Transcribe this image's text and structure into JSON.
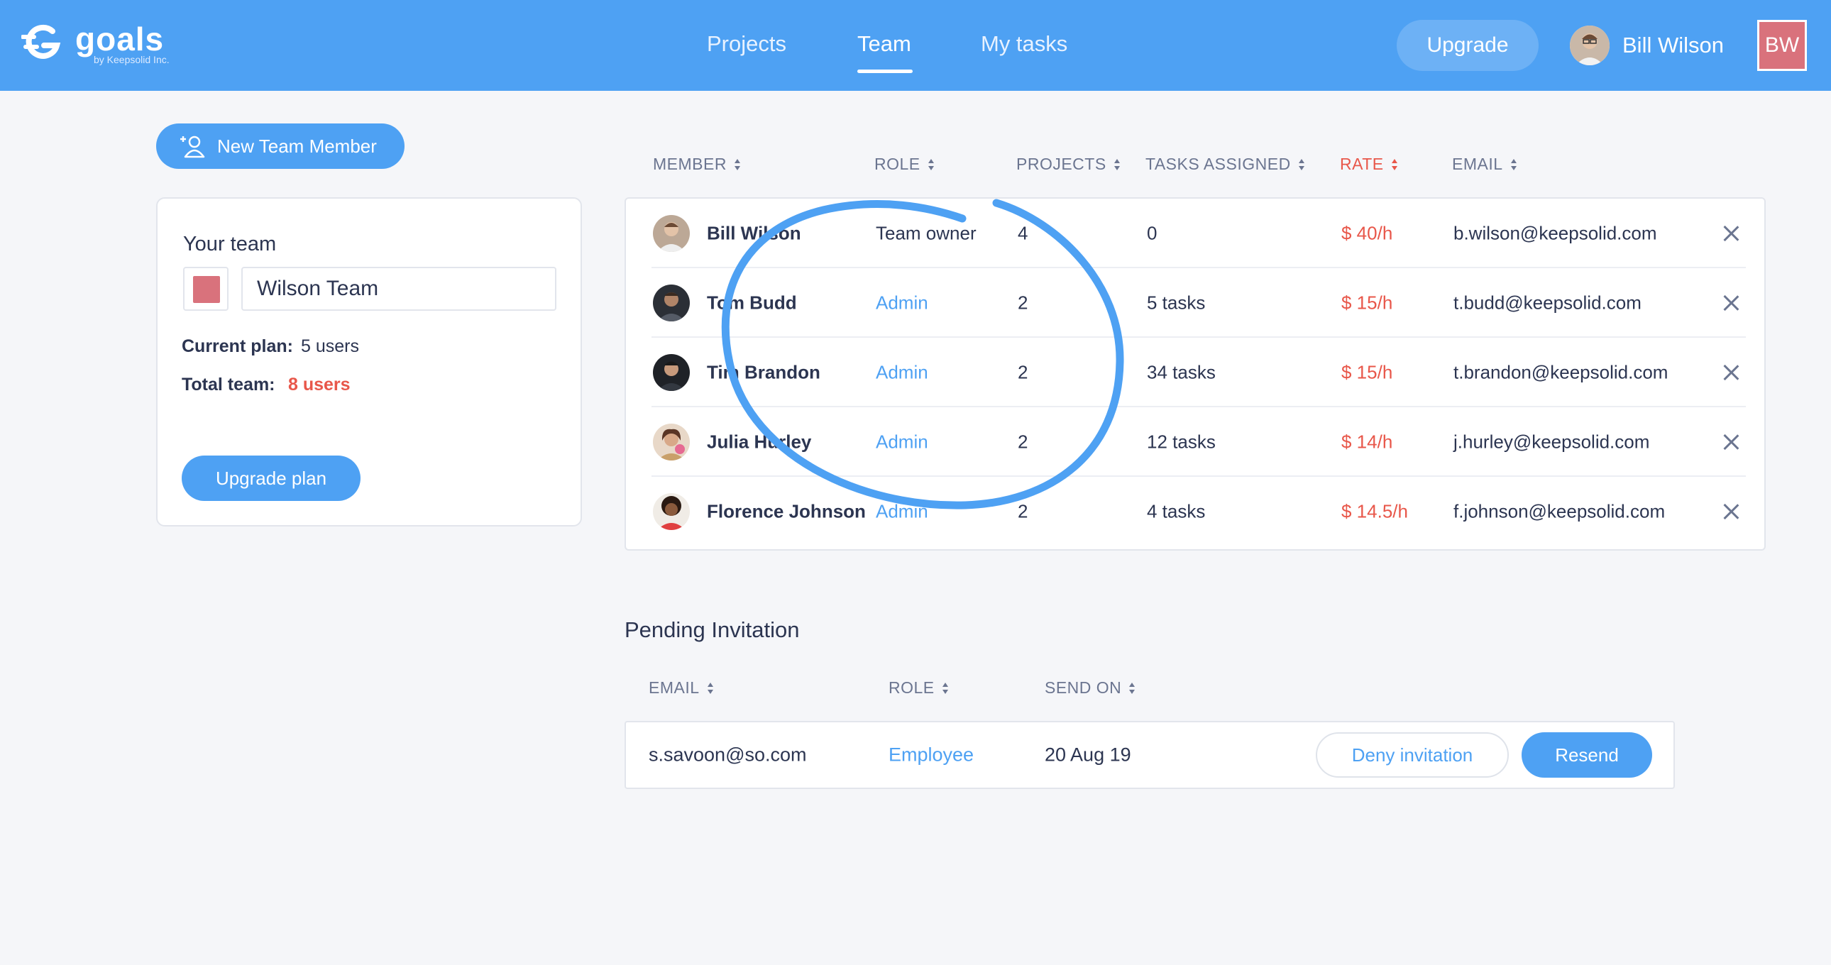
{
  "header": {
    "logo_word": "goals",
    "logo_sub": "by Keepsolid Inc.",
    "nav": [
      "Projects",
      "Team",
      "My tasks"
    ],
    "upgrade_label": "Upgrade",
    "user_name": "Bill Wilson",
    "user_initials": "BW"
  },
  "sidebar": {
    "new_member_label": "New Team Member",
    "card_title": "Your team",
    "team_name": "Wilson Team",
    "current_plan_label": "Current plan:",
    "current_plan_value": "5 users",
    "total_team_label": "Total team:",
    "total_team_value": "8 users",
    "upgrade_plan_label": "Upgrade plan",
    "team_color": "#d9727c"
  },
  "members": {
    "columns": [
      "MEMBER",
      "ROLE",
      "PROJECTS",
      "TASKS ASSIGNED",
      "RATE",
      "EMAIL"
    ],
    "rows": [
      {
        "name": "Bill Wilson",
        "role": "Team owner",
        "projects": "4",
        "tasks": "0",
        "rate": "$ 40/h",
        "email": "b.wilson@keepsolid.com"
      },
      {
        "name": "Tom Budd",
        "role": "Admin",
        "projects": "2",
        "tasks": "5 tasks",
        "rate": "$ 15/h",
        "email": "t.budd@keepsolid.com"
      },
      {
        "name": "Tim Brandon",
        "role": "Admin",
        "projects": "2",
        "tasks": "34 tasks",
        "rate": "$ 15/h",
        "email": "t.brandon@keepsolid.com"
      },
      {
        "name": "Julia Hurley",
        "role": "Admin",
        "projects": "2",
        "tasks": "12 tasks",
        "rate": "$ 14/h",
        "email": "j.hurley@keepsolid.com"
      },
      {
        "name": "Florence Johnson",
        "role": "Admin",
        "projects": "2",
        "tasks": "4 tasks",
        "rate": "$ 14.5/h",
        "email": "f.johnson@keepsolid.com"
      }
    ]
  },
  "pending": {
    "title": "Pending Invitation",
    "columns": [
      "EMAIL",
      "ROLE",
      "SEND ON"
    ],
    "row": {
      "email": "s.savoon@so.com",
      "role": "Employee",
      "sent_on": "20 Aug 19"
    },
    "deny_label": "Deny invitation",
    "resend_label": "Resend"
  },
  "colors": {
    "brand": "#4ea1f3",
    "accent_red": "#e8574a",
    "background": "#f5f6f9"
  }
}
